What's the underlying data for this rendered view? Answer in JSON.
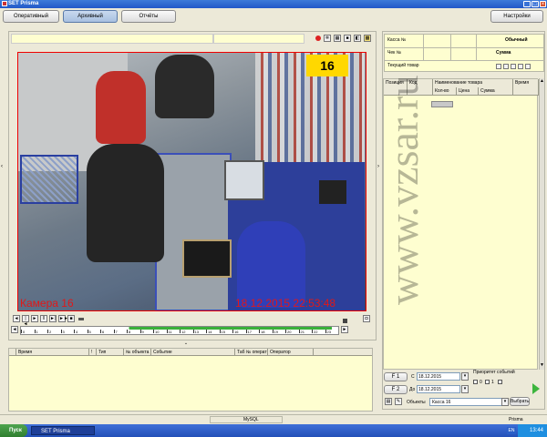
{
  "window": {
    "title": "SET Prisma"
  },
  "toolbar": {
    "tab_operative": "Оперативный",
    "tab_archive": "Архивный",
    "tab_reports": "Отчёты",
    "settings": "Настройки"
  },
  "video": {
    "camera_label": "Камера 16",
    "timestamp": "18.12.2015 22:53:48"
  },
  "timeline": {
    "ticks": [
      "0",
      "1",
      "2",
      "3",
      "4",
      "5",
      "6",
      "7",
      "8",
      "9",
      "10",
      "11",
      "12",
      "13",
      "14",
      "15",
      "16",
      "17",
      "18",
      "19",
      "20",
      "21",
      "22",
      "23"
    ]
  },
  "events_table": {
    "columns": [
      "Время",
      "!",
      "Тип",
      "№ объекта",
      "Событие",
      "Таб № операт",
      "Оператор"
    ]
  },
  "receipt": {
    "kassa_label": "Касса №",
    "check_label": "Чек №",
    "current_item_label": "Текущий товар",
    "type_value": "Обычный",
    "sum_label": "Сумма"
  },
  "items_table": {
    "col_position": "Позиция",
    "col_code": "Код",
    "col_name": "Наименование товара",
    "col_time": "Время",
    "col_qty": "Кол-во",
    "col_price": "Цена",
    "col_sum": "Сумма"
  },
  "filters": {
    "f1": "F 1",
    "f2": "F 2",
    "from_label": "С",
    "to_label": "До",
    "from_date": "18.12.2015",
    "to_date": "18.12.2015",
    "priority_label": "Приоритет событий",
    "prio_0": "0",
    "prio_1": "1",
    "objects_label": "Объекты",
    "objects_value": "Касса 16",
    "select_btn": "Выбрать"
  },
  "statusbar": {
    "db": "MySQL",
    "app": "Prisma"
  },
  "taskbar": {
    "start": "Пуск",
    "task": "SET Prisma",
    "clock": "13:44",
    "lang": "EN"
  },
  "watermark": "www.vzsar.ru"
}
